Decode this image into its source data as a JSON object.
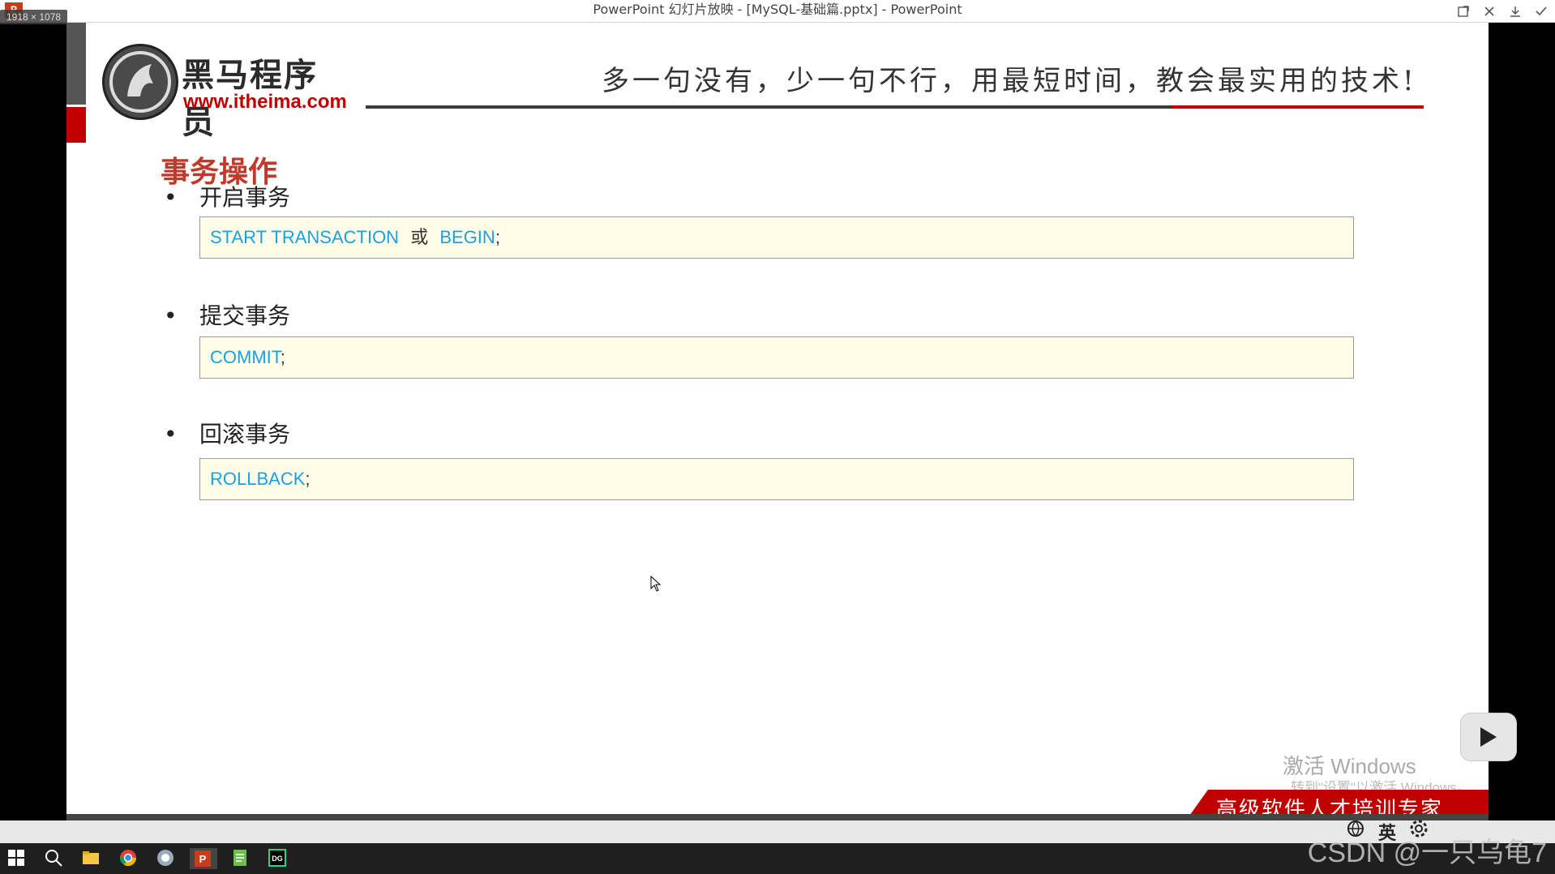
{
  "window": {
    "title": "PowerPoint 幻灯片放映 - [MySQL-基础篇.pptx] - PowerPoint",
    "dimensions_badge": "1918 × 1078",
    "app_icon": "P"
  },
  "slide": {
    "logo": {
      "name_cn": "黑马程序员",
      "url": "www.itheima.com"
    },
    "slogan": "多一句没有，少一句不行，用最短时间，教会最实用的技术!",
    "heading": "事务操作",
    "sections": [
      {
        "bullet": "开启事务",
        "code": {
          "kw1": "START  TRANSACTION",
          "mid": "或",
          "kw2": "BEGIN",
          "end": ";"
        }
      },
      {
        "bullet": "提交事务",
        "code": {
          "kw1": "COMMIT",
          "end": ";"
        }
      },
      {
        "bullet": "回滚事务",
        "code": {
          "kw1": "ROLLBACK",
          "end": ";"
        }
      }
    ],
    "banner": "高级软件人才培训专家",
    "activation_title": "激活 Windows",
    "activation_sub": "转到\"设置\"以激活 Windows。"
  },
  "overlay": {
    "watermark": "CSDN @一只乌龟7",
    "tray_lang": "英"
  },
  "colors": {
    "accent_red": "#c00000",
    "keyword_blue": "#1ba1e2",
    "code_bg": "#fffde8"
  },
  "icons": {
    "title_controls": [
      "external-icon",
      "close-icon",
      "download-icon",
      "check-icon"
    ],
    "taskbar": [
      "windows-start-icon",
      "search-icon",
      "file-explorer-icon",
      "chrome-icon",
      "app-icon",
      "powerpoint-icon",
      "notepad-icon",
      "datagrip-icon"
    ]
  }
}
